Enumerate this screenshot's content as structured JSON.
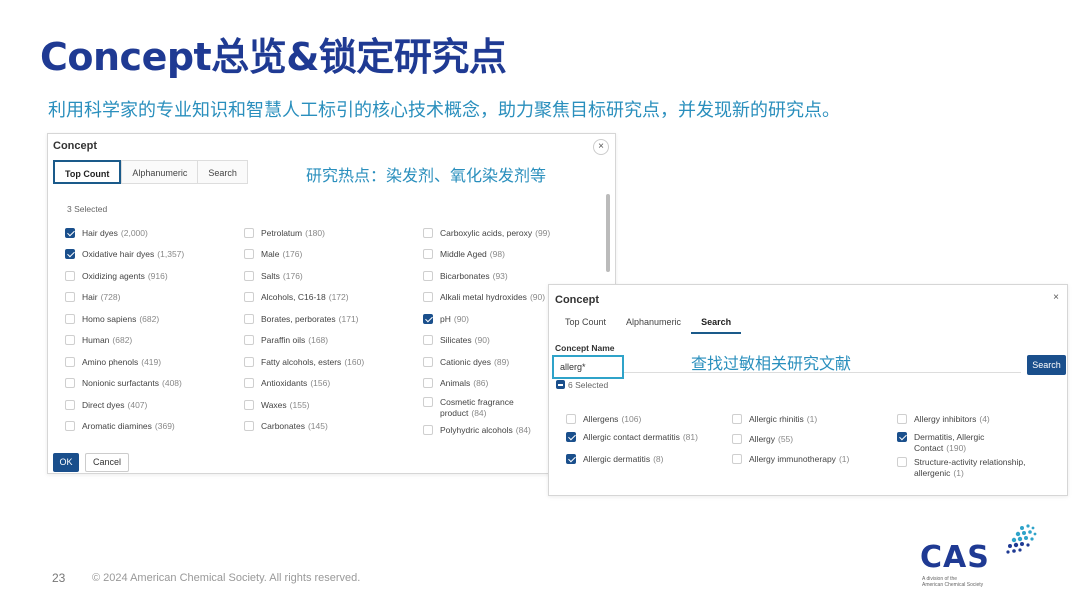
{
  "slide": {
    "title": "Concept总览&锁定研究点",
    "subtitle": "利用科学家的专业知识和智慧人工标引的核心技术概念，助力聚焦目标研究点，并发现新的研究点。",
    "page_number": "23",
    "copyright": "© 2024 American Chemical Society. All rights reserved.",
    "logo_text": "CAS",
    "logo_sub1": "A division of the",
    "logo_sub2": "American Chemical Society"
  },
  "dialog1": {
    "title": "Concept",
    "close": "×",
    "tabs": [
      "Top Count",
      "Alphanumeric",
      "Search"
    ],
    "selected_count": "3 Selected",
    "annotation": "研究热点：染发剂、氧化染发剂等",
    "ok_label": "OK",
    "cancel_label": "Cancel",
    "columns": [
      [
        {
          "label": "Hair dyes",
          "count": "(2,000)",
          "checked": true
        },
        {
          "label": "Oxidative hair dyes",
          "count": "(1,357)",
          "checked": true
        },
        {
          "label": "Oxidizing agents",
          "count": "(916)",
          "checked": false
        },
        {
          "label": "Hair",
          "count": "(728)",
          "checked": false
        },
        {
          "label": "Homo sapiens",
          "count": "(682)",
          "checked": false
        },
        {
          "label": "Human",
          "count": "(682)",
          "checked": false
        },
        {
          "label": "Amino phenols",
          "count": "(419)",
          "checked": false
        },
        {
          "label": "Nonionic surfactants",
          "count": "(408)",
          "checked": false
        },
        {
          "label": "Direct dyes",
          "count": "(407)",
          "checked": false
        },
        {
          "label": "Aromatic diamines",
          "count": "(369)",
          "checked": false
        }
      ],
      [
        {
          "label": "Petrolatum",
          "count": "(180)",
          "checked": false
        },
        {
          "label": "Male",
          "count": "(176)",
          "checked": false
        },
        {
          "label": "Salts",
          "count": "(176)",
          "checked": false
        },
        {
          "label": "Alcohols, C16-18",
          "count": "(172)",
          "checked": false
        },
        {
          "label": "Borates, perborates",
          "count": "(171)",
          "checked": false
        },
        {
          "label": "Paraffin oils",
          "count": "(168)",
          "checked": false
        },
        {
          "label": "Fatty alcohols, esters",
          "count": "(160)",
          "checked": false
        },
        {
          "label": "Antioxidants",
          "count": "(156)",
          "checked": false
        },
        {
          "label": "Waxes",
          "count": "(155)",
          "checked": false
        },
        {
          "label": "Carbonates",
          "count": "(145)",
          "checked": false
        }
      ],
      [
        {
          "label": "Carboxylic acids, peroxy",
          "count": "(99)",
          "checked": false
        },
        {
          "label": "Middle Aged",
          "count": "(98)",
          "checked": false
        },
        {
          "label": "Bicarbonates",
          "count": "(93)",
          "checked": false
        },
        {
          "label": "Alkali metal hydroxides",
          "count": "(90)",
          "checked": false
        },
        {
          "label": "pH",
          "count": "(90)",
          "checked": true
        },
        {
          "label": "Silicates",
          "count": "(90)",
          "checked": false
        },
        {
          "label": "Cationic dyes",
          "count": "(89)",
          "checked": false
        },
        {
          "label": "Animals",
          "count": "(86)",
          "checked": false
        },
        {
          "label": "Cosmetic fragrance product",
          "count": "(84)",
          "checked": false
        },
        {
          "label": "Polyhydric alcohols",
          "count": "(84)",
          "checked": false
        }
      ]
    ]
  },
  "dialog2": {
    "title": "Concept",
    "close": "×",
    "tabs": [
      "Top Count",
      "Alphanumeric",
      "Search"
    ],
    "field_label": "Concept Name",
    "search_value": "allerg*",
    "annotation": "查找过敏相关研究文献",
    "search_button": "Search",
    "selected_count": "6 Selected",
    "columns": [
      [
        {
          "label": "Allergens",
          "count": "(106)",
          "checked": false
        },
        {
          "label": "Allergic contact dermatitis",
          "count": "(81)",
          "checked": true
        },
        {
          "label": "Allergic dermatitis",
          "count": "(8)",
          "checked": true
        }
      ],
      [
        {
          "label": "Allergic rhinitis",
          "count": "(1)",
          "checked": false
        },
        {
          "label": "Allergy",
          "count": "(55)",
          "checked": false
        },
        {
          "label": "Allergy immunotherapy",
          "count": "(1)",
          "checked": false
        }
      ],
      [
        {
          "label": "Allergy inhibitors",
          "count": "(4)",
          "checked": false
        },
        {
          "label": "Dermatitis, Allergic Contact",
          "count": "(190)",
          "checked": true
        },
        {
          "label": "Structure-activity relationship, allergenic",
          "count": "(1)",
          "checked": false
        }
      ]
    ]
  },
  "colors": {
    "title": "#1f3a93",
    "accent": "#2a8fbd",
    "primary_button": "#1a4f8c",
    "highlight_border": "#2fa3c9"
  }
}
